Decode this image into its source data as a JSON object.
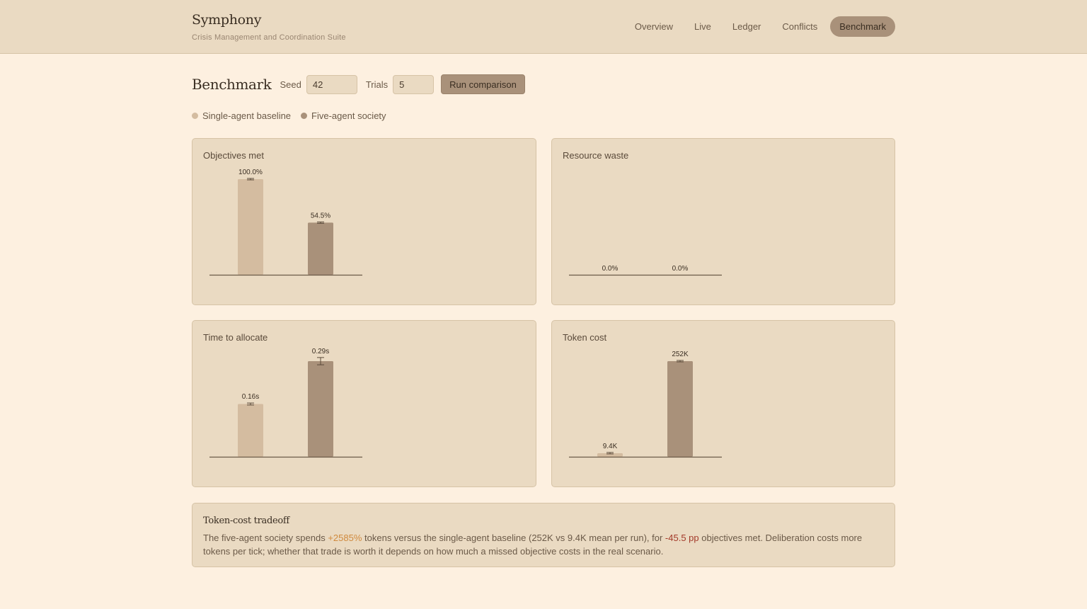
{
  "app": {
    "title": "Symphony",
    "subtitle": "Crisis Management and Coordination Suite"
  },
  "nav": {
    "items": [
      {
        "label": "Overview"
      },
      {
        "label": "Live"
      },
      {
        "label": "Ledger"
      },
      {
        "label": "Conflicts"
      },
      {
        "label": "Benchmark",
        "active": true
      }
    ]
  },
  "controls": {
    "title": "Benchmark",
    "seed_label": "Seed",
    "seed_value": "42",
    "trials_label": "Trials",
    "trials_value": "5",
    "run_label": "Run comparison"
  },
  "legend": [
    {
      "name": "Single-agent baseline",
      "color": "#d4bca0"
    },
    {
      "name": "Five-agent society",
      "color": "#a9917a"
    }
  ],
  "chart_data": [
    {
      "type": "bar",
      "title": "Objectives met",
      "series_names": [
        "Single-agent baseline",
        "Five-agent society"
      ],
      "values": [
        100.0,
        54.5
      ],
      "labels": [
        "100.0%",
        "54.5%"
      ],
      "ylim": [
        0,
        100
      ],
      "error": [
        0,
        0
      ]
    },
    {
      "type": "bar",
      "title": "Resource waste",
      "series_names": [
        "Single-agent baseline",
        "Five-agent society"
      ],
      "values": [
        0.0,
        0.0
      ],
      "labels": [
        "0.0%",
        "0.0%"
      ],
      "ylim": [
        0,
        100
      ],
      "error": [
        0,
        0
      ]
    },
    {
      "type": "bar",
      "title": "Time to allocate",
      "series_names": [
        "Single-agent baseline",
        "Five-agent society"
      ],
      "values": [
        0.16,
        0.29
      ],
      "labels": [
        "0.16s",
        "0.29s"
      ],
      "ylim": [
        0,
        0.29
      ],
      "error": [
        0.003,
        0.011
      ]
    },
    {
      "type": "bar",
      "title": "Token cost",
      "series_names": [
        "Single-agent baseline",
        "Five-agent society"
      ],
      "values": [
        9400,
        252000
      ],
      "labels": [
        "9.4K",
        "252K"
      ],
      "ylim": [
        0,
        252000
      ],
      "error": [
        0,
        0
      ]
    }
  ],
  "tradeoff": {
    "title": "Token-cost tradeoff",
    "text_1": "The five-agent society spends ",
    "token_delta": "+2585%",
    "text_2": " tokens versus the single-agent baseline (252K vs 9.4K mean per run), for ",
    "objective_delta": "-45.5 pp",
    "text_3": " objectives met. Deliberation costs more tokens per tick; whether that trade is worth it depends on how much a missed objective costs in the real scenario."
  },
  "colors": {
    "baseline": "#d4bca0",
    "society": "#a9917a",
    "axis": "#6b5a48",
    "positive": "#d08a3e",
    "negative": "#a33a2a"
  }
}
